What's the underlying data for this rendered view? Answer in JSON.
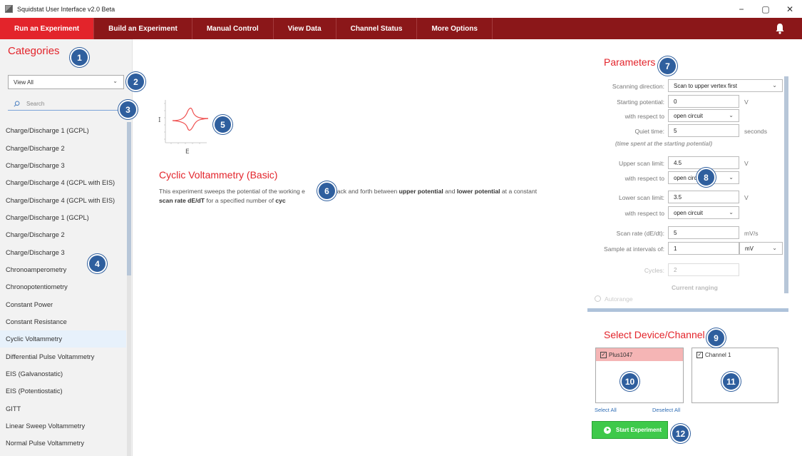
{
  "window": {
    "title": "Squidstat User Interface v2.0 Beta",
    "controls": [
      "−",
      "▢",
      "✕"
    ]
  },
  "nav": {
    "items": [
      "Run an Experiment",
      "Build an Experiment",
      "Manual Control",
      "View Data",
      "Channel Status",
      "More Options"
    ],
    "active": "Run an Experiment",
    "notification_icon": "bell-icon"
  },
  "categories": {
    "title": "Categories",
    "filter_value": "View All",
    "search_placeholder": "Search",
    "items": [
      "Charge/Discharge 1 (GCPL)",
      "Charge/Discharge 2",
      "Charge/Discharge 3",
      "Charge/Discharge 4 (GCPL with EIS)",
      "Charge/Discharge 4 (GCPL with EIS)",
      "Charge/Discharge 1 (GCPL)",
      "Charge/Discharge 2",
      "Charge/Discharge 3",
      "Chronoamperometry",
      "Chronopotentiometry",
      "Constant Power",
      "Constant Resistance",
      "Cyclic Voltammetry",
      "Differential Pulse Voltammetry",
      "EIS (Galvanostatic)",
      "EIS (Potentiostatic)",
      "GITT",
      "Linear Sweep Voltammetry",
      "Normal Pulse Voltammetry"
    ],
    "selected": "Cyclic Voltammetry"
  },
  "experiment": {
    "plot_y_label": "I",
    "plot_x_label": "E",
    "title": "Cyclic Voltammetry (Basic)",
    "desc_1": "This experiment sweeps the potential of the working e",
    "desc_2": "back and forth between ",
    "desc_upper": "upper potential",
    "desc_3": " and ",
    "desc_lower": "lower potential",
    "desc_4": " at a constant ",
    "desc_rate": "scan rate dE/dT",
    "desc_5": " for a specified number of ",
    "desc_cycles": "cyc"
  },
  "parameters": {
    "title": "Parameters",
    "scanning_direction_label": "Scanning direction:",
    "scanning_direction_value": "Scan to upper vertex first",
    "starting_potential_label": "Starting potential:",
    "starting_potential_value": "0",
    "starting_potential_unit": "V",
    "wrt_label_1": "with respect to",
    "wrt_value_1": "open circuit",
    "quiet_time_label": "Quiet time:",
    "quiet_time_value": "5",
    "quiet_time_unit": "seconds",
    "quiet_time_note": "(time spent at the starting potential)",
    "upper_scan_label": "Upper scan limit:",
    "upper_scan_value": "4.5",
    "upper_scan_unit": "V",
    "wrt_label_2": "with respect to",
    "wrt_value_2": "open circ",
    "lower_scan_label": "Lower scan limit:",
    "lower_scan_value": "3.5",
    "lower_scan_unit": "V",
    "wrt_label_3": "with respect to",
    "wrt_value_3": "open circuit",
    "scan_rate_label": "Scan rate (dE/dt):",
    "scan_rate_value": "5",
    "scan_rate_unit": "mV/s",
    "sample_label": "Sample at intervals of:",
    "sample_value": "1",
    "sample_unit": "mV",
    "cycles_label": "Cycles:",
    "cycles_value": "2",
    "current_ranging_label": "Current ranging",
    "autorange_label": "Autorange"
  },
  "device": {
    "title": "Select Device/Channel",
    "device_name": "Plus1047",
    "channel_name": "Channel 1",
    "select_all": "Select All",
    "deselect_all": "Deselect All",
    "start_label": "Start Experiment"
  },
  "badges": [
    "1",
    "2",
    "3",
    "4",
    "5",
    "6",
    "7",
    "8",
    "9",
    "10",
    "11",
    "12"
  ],
  "colors": {
    "brand_red": "#8b1719",
    "accent_red": "#e3242b",
    "start_green": "#3ec94a",
    "badge_blue": "#2f5f9e"
  }
}
